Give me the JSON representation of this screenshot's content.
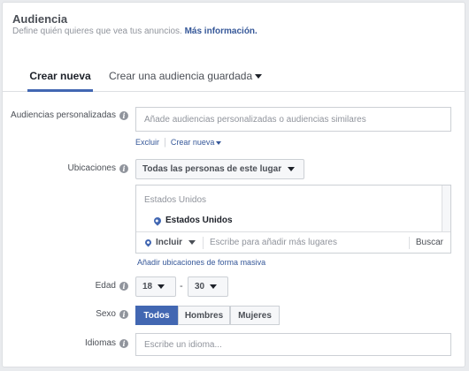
{
  "header": {
    "title": "Audiencia",
    "subtitle": "Define quién quieres que vea tus anuncios.",
    "more_info": "Más información."
  },
  "tabs": [
    {
      "label": "Crear nueva",
      "active": true
    },
    {
      "label": "Crear una audiencia guardada",
      "active": false
    }
  ],
  "custom_audiences": {
    "label": "Audiencias personalizadas",
    "placeholder": "Añade audiencias personalizadas o audiencias similares",
    "exclude": "Excluir",
    "create_new": "Crear nueva"
  },
  "locations": {
    "label": "Ubicaciones",
    "dropdown": "Todas las personas de este lugar",
    "country_header": "Estados Unidos",
    "selected": "Estados Unidos",
    "include": "Incluir",
    "search_placeholder": "Escribe para añadir más lugares",
    "search_button": "Buscar",
    "bulk_link": "Añadir ubicaciones de forma masiva"
  },
  "age": {
    "label": "Edad",
    "min": "18",
    "dash": "-",
    "max": "30"
  },
  "gender": {
    "label": "Sexo",
    "options": [
      "Todos",
      "Hombres",
      "Mujeres"
    ],
    "selected": "Todos"
  },
  "languages": {
    "label": "Idiomas",
    "placeholder": "Escribe un idioma..."
  },
  "colors": {
    "accent": "#4267b2",
    "link": "#365899"
  }
}
